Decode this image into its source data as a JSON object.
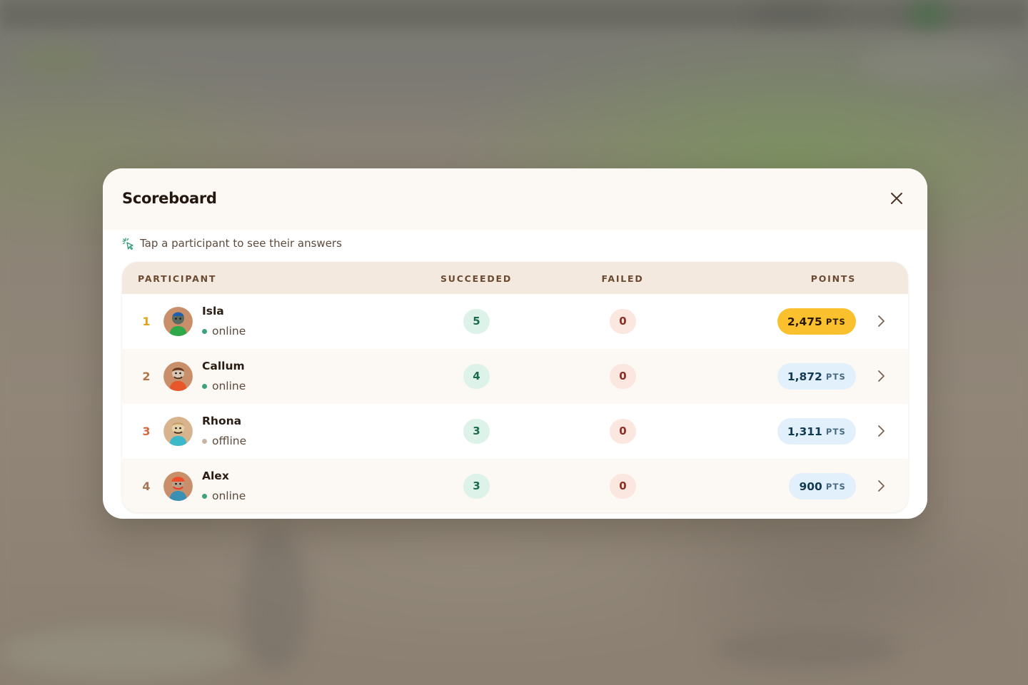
{
  "modal": {
    "title": "Scoreboard",
    "hint": "Tap a participant to see their answers"
  },
  "table": {
    "columns": {
      "participant": "PARTICIPANT",
      "succeeded": "SUCCEEDED",
      "failed": "FAILED",
      "points": "POINTS"
    },
    "rows": [
      {
        "rank": "1",
        "name": "Isla",
        "status": "online",
        "succeeded": "5",
        "failed": "0",
        "points": "2,475",
        "unit": "PTS"
      },
      {
        "rank": "2",
        "name": "Callum",
        "status": "online",
        "succeeded": "4",
        "failed": "0",
        "points": "1,872",
        "unit": "PTS"
      },
      {
        "rank": "3",
        "name": "Rhona",
        "status": "offline",
        "succeeded": "3",
        "failed": "0",
        "points": "1,311",
        "unit": "PTS"
      },
      {
        "rank": "4",
        "name": "Alex",
        "status": "online",
        "succeeded": "3",
        "failed": "0",
        "points": "900",
        "unit": "PTS"
      }
    ]
  },
  "colors": {
    "rank_1": "#e0a21a",
    "rank_2": "#b0754a",
    "rank_3": "#d2693f",
    "rank_4": "#a47658",
    "online_dot": "#3aa37a",
    "offline_dot": "#c9b3a3",
    "points_gold_bg": "#fbc02d",
    "points_gold_text": "#2a1a05",
    "points_blue_bg": "#e2f0fb",
    "points_blue_text": "#123a52"
  },
  "icons": {
    "close": "close-icon",
    "hint": "tap-sparkle-icon",
    "row_action": "chevron-right-icon"
  }
}
